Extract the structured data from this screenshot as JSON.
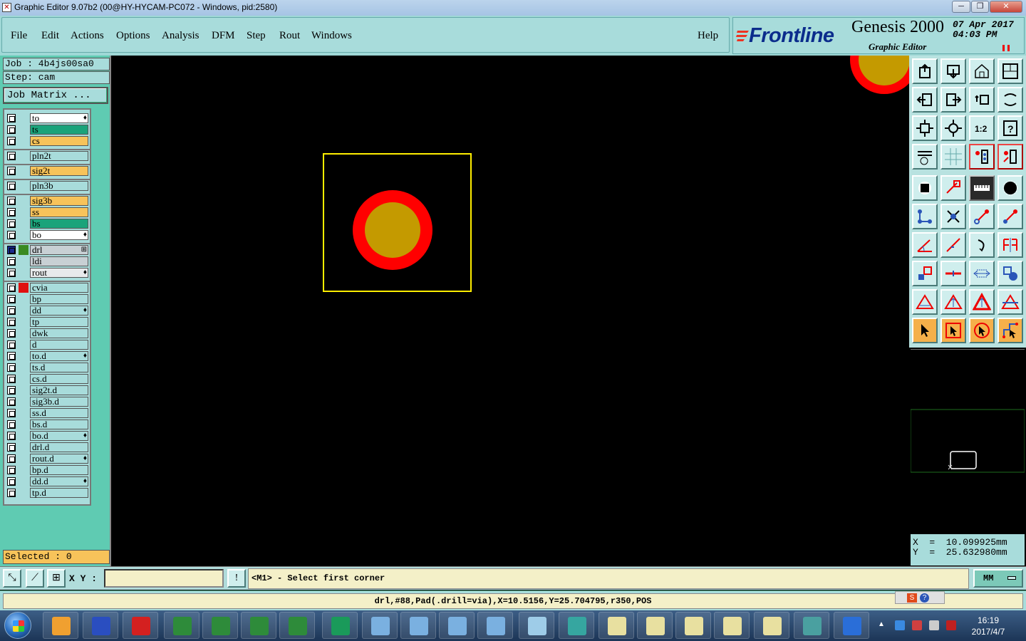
{
  "window": {
    "title": "Graphic Editor 9.07b2 (00@HY-HYCAM-PC072 - Windows, pid:2580)",
    "buttons": {
      "minimize": "─",
      "maximize": "❐",
      "close": "✕"
    }
  },
  "menu": {
    "items": [
      "File",
      "Edit",
      "Actions",
      "Options",
      "Analysis",
      "DFM",
      "Step",
      "Rout",
      "Windows"
    ],
    "help": "Help"
  },
  "brand": {
    "logo": "Frontline",
    "product": "Genesis 2000",
    "subtitle": "Graphic Editor",
    "date": "07 Apr 2017",
    "time": "04:03 PM"
  },
  "job": {
    "job_line": "Job : 4b4js00sa0",
    "step_line": "Step: cam",
    "matrix_button": "Job Matrix ..."
  },
  "layers": [
    {
      "name": "to",
      "color": "#ffffff",
      "mark": "♦"
    },
    {
      "name": "ts",
      "color": "#1aa37a",
      "mark": ""
    },
    {
      "name": "cs",
      "color": "#f7c35a",
      "mark": ""
    },
    {
      "name": "pln2t",
      "color": "#a8dcdb",
      "mark": ""
    },
    {
      "name": "sig2t",
      "color": "#f7c35a",
      "mark": ""
    },
    {
      "name": "pln3b",
      "color": "#a8dcdb",
      "mark": ""
    },
    {
      "name": "sig3b",
      "color": "#f7c35a",
      "mark": ""
    },
    {
      "name": "ss",
      "color": "#f7c35a",
      "mark": ""
    },
    {
      "name": "bs",
      "color": "#1aa37a",
      "mark": ""
    },
    {
      "name": "bo",
      "color": "#ffffff",
      "mark": "♦"
    },
    {
      "name": "drl",
      "color": "#c8d0d4",
      "mark": "⊞",
      "swatch": "#3a8a22",
      "cbcolor": "#1a2a8c"
    },
    {
      "name": "ldi",
      "color": "#c8d0d4",
      "mark": ""
    },
    {
      "name": "rout",
      "color": "#e8eaec",
      "mark": "♦"
    },
    {
      "name": "cvia",
      "color": "#a8dcdb",
      "mark": "",
      "swatch": "#e01010"
    },
    {
      "name": "bp",
      "color": "#a8dcdb",
      "mark": ""
    },
    {
      "name": "dd",
      "color": "#a8dcdb",
      "mark": "♦"
    },
    {
      "name": "tp",
      "color": "#a8dcdb",
      "mark": ""
    },
    {
      "name": "dwk",
      "color": "#a8dcdb",
      "mark": ""
    },
    {
      "name": "d",
      "color": "#a8dcdb",
      "mark": ""
    },
    {
      "name": "to.d",
      "color": "#a8dcdb",
      "mark": "♦"
    },
    {
      "name": "ts.d",
      "color": "#a8dcdb",
      "mark": ""
    },
    {
      "name": "cs.d",
      "color": "#a8dcdb",
      "mark": ""
    },
    {
      "name": "sig2t.d",
      "color": "#a8dcdb",
      "mark": ""
    },
    {
      "name": "sig3b.d",
      "color": "#a8dcdb",
      "mark": ""
    },
    {
      "name": "ss.d",
      "color": "#a8dcdb",
      "mark": ""
    },
    {
      "name": "bs.d",
      "color": "#a8dcdb",
      "mark": ""
    },
    {
      "name": "bo.d",
      "color": "#a8dcdb",
      "mark": "♦"
    },
    {
      "name": "drl.d",
      "color": "#a8dcdb",
      "mark": ""
    },
    {
      "name": "rout.d",
      "color": "#a8dcdb",
      "mark": "♦"
    },
    {
      "name": "bp.d",
      "color": "#a8dcdb",
      "mark": ""
    },
    {
      "name": "dd.d",
      "color": "#a8dcdb",
      "mark": "♦"
    },
    {
      "name": "tp.d",
      "color": "#a8dcdb",
      "mark": ""
    }
  ],
  "selected": "Selected : 0",
  "coords": {
    "x": "X  =  10.099925mm",
    "y": "Y  =  25.632980mm"
  },
  "command": {
    "xy_label": "X Y :",
    "xy_value": "",
    "prompt": "<M1> - Select first corner",
    "units": "MM"
  },
  "status": "drl,#88,Pad(.drill=via),X=10.5156,Y=25.704795,r350,POS",
  "taskbar": {
    "clock_time": "16:19",
    "clock_date": "2017/4/7"
  },
  "colors": {
    "pad_outer": "#ff0000",
    "pad_inner": "#c49a00",
    "selection_box": "#ffee00",
    "panel": "#a8dcdb"
  }
}
